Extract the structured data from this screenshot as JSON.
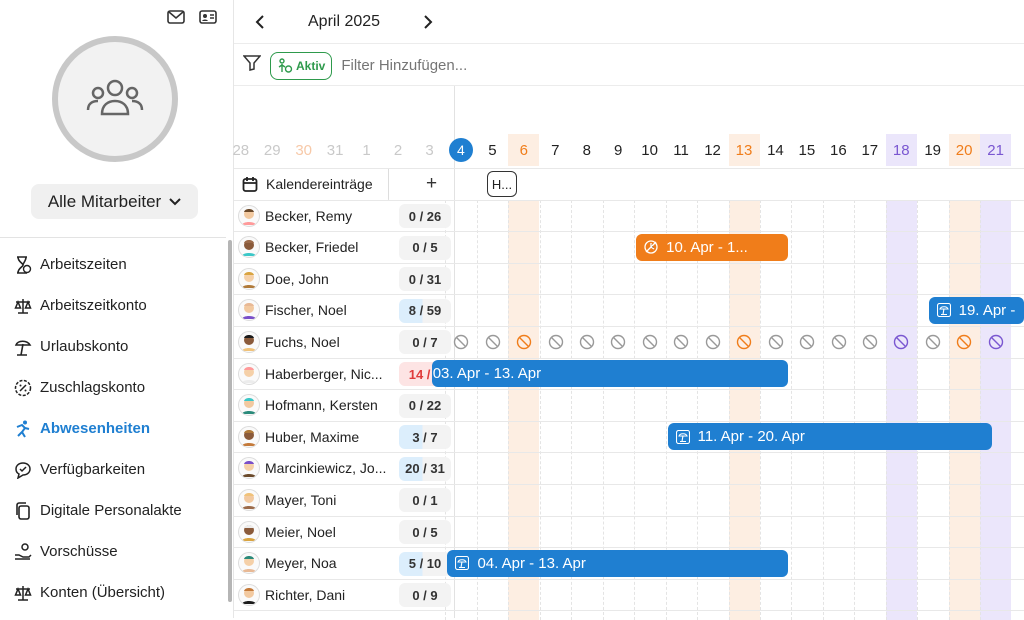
{
  "sidebar": {
    "group_label": "Alle Mitarbeiter",
    "nav": [
      {
        "label": "Arbeitszeiten",
        "icon": "hourglass-clock-icon",
        "active": false
      },
      {
        "label": "Arbeitszeitkonto",
        "icon": "scale-icon",
        "active": false
      },
      {
        "label": "Urlaubskonto",
        "icon": "beach-umbrella-icon",
        "active": false
      },
      {
        "label": "Zuschlagskonto",
        "icon": "percent-badge-icon",
        "active": false
      },
      {
        "label": "Abwesenheiten",
        "icon": "running-person-icon",
        "active": true
      },
      {
        "label": "Verfügbarkeiten",
        "icon": "chat-check-icon",
        "active": false
      },
      {
        "label": "Digitale Personalakte",
        "icon": "copy-documents-icon",
        "active": false
      },
      {
        "label": "Vorschüsse",
        "icon": "hand-coin-icon",
        "active": false
      },
      {
        "label": "Konten (Übersicht)",
        "icon": "scale-icon",
        "active": false
      }
    ]
  },
  "header": {
    "month": "April 2025"
  },
  "filter": {
    "chip_label": "Aktiv",
    "placeholder": "Filter Hinzufügen..."
  },
  "calendar": {
    "days": [
      "28",
      "29",
      "30",
      "31",
      "1",
      "2",
      "3",
      "4",
      "5",
      "6",
      "7",
      "8",
      "9",
      "10",
      "11",
      "12",
      "13",
      "14",
      "15",
      "16",
      "17",
      "18",
      "19",
      "20",
      "21"
    ],
    "entries_label": "Kalendereinträge",
    "holiday_chip": "H..."
  },
  "employees": [
    {
      "name": "Becker, Remy",
      "count": "0 / 26"
    },
    {
      "name": "Becker, Friedel",
      "count": "0 / 5"
    },
    {
      "name": "Doe, John",
      "count": "0 / 31"
    },
    {
      "name": "Fischer, Noel",
      "count": "8 / 59"
    },
    {
      "name": "Fuchs, Noel",
      "count": "0 / 7"
    },
    {
      "name": "Haberberger, Nic...",
      "count": "14 / 9"
    },
    {
      "name": "Hofmann, Kersten",
      "count": "0 / 22"
    },
    {
      "name": "Huber, Maxime",
      "count": "3 / 7"
    },
    {
      "name": "Marcinkiewicz, Jo...",
      "count": "20 / 31"
    },
    {
      "name": "Mayer, Toni",
      "count": "0 / 1"
    },
    {
      "name": "Meier, Noel",
      "count": "0 / 5"
    },
    {
      "name": "Meyer, Noa",
      "count": "5 / 10"
    },
    {
      "name": "Richter, Dani",
      "count": "0 / 9"
    }
  ],
  "absences": [
    {
      "label": "10. Apr - 1...",
      "color": "#f07d1a",
      "icon": "clock-slash-icon"
    },
    {
      "label": "19. Apr -",
      "color": "#1f7fd1",
      "icon": "beach-umbrella-icon"
    },
    {
      "label": "03. Apr - 13. Apr",
      "color": "#1f7fd1",
      "icon": ""
    },
    {
      "label": "11. Apr - 20. Apr",
      "color": "#1f7fd1",
      "icon": "beach-umbrella-icon"
    },
    {
      "label": "04. Apr - 13. Apr",
      "color": "#1f7fd1",
      "icon": "beach-umbrella-icon"
    }
  ],
  "colors": {
    "accent": "#1f7fd1",
    "sunday": "#f07d1a",
    "saturday": "#7a57d1",
    "active_chip": "#2e9a4c"
  }
}
